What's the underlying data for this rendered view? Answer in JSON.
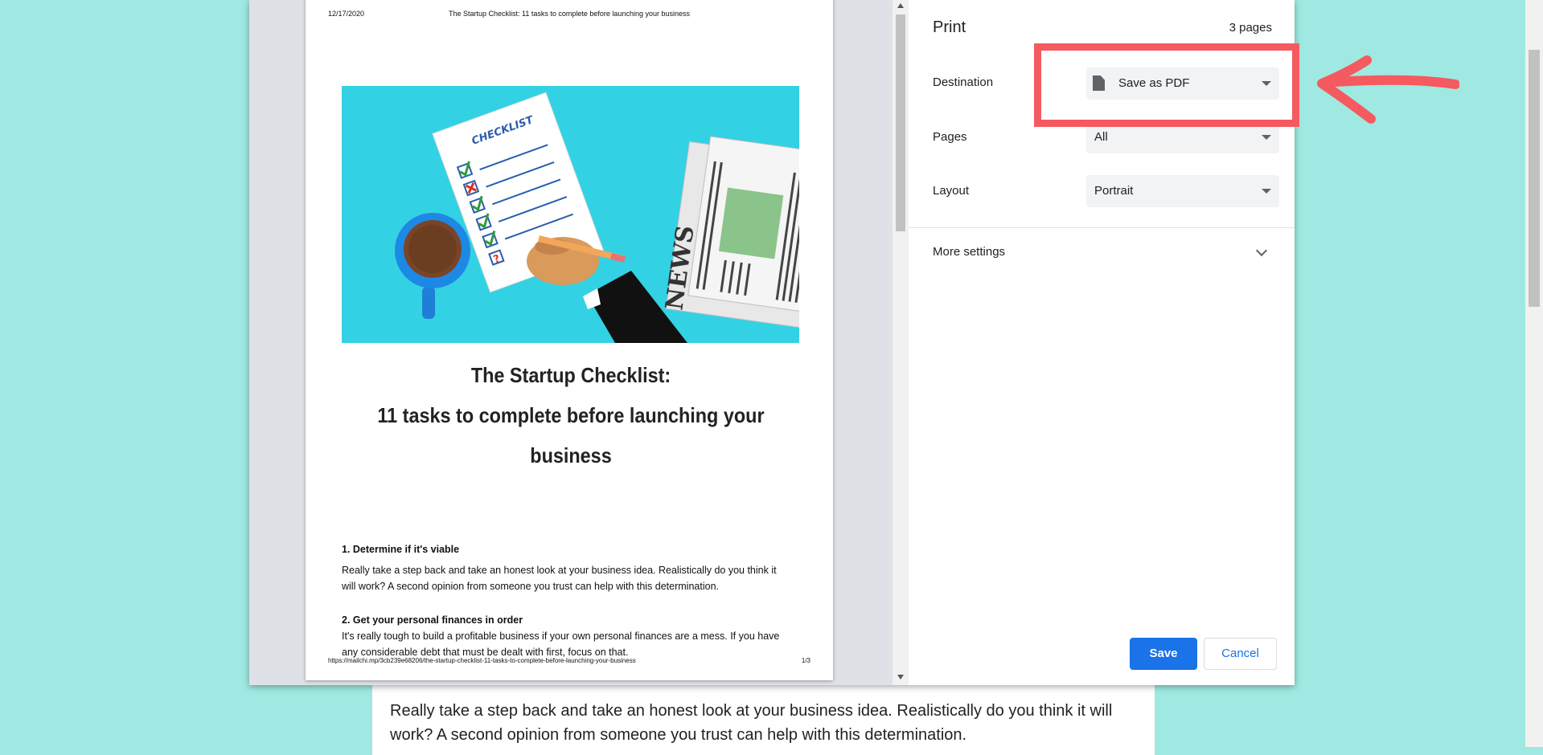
{
  "article": {
    "text": "Really take a step back and take an honest look at your business idea. Realistically do you think it will work? A second opinion from someone you trust can help with this determination."
  },
  "preview": {
    "header_date": "12/17/2020",
    "header_title": "The Startup Checklist: 11 tasks to complete before launching your business",
    "hero": {
      "checklist_label": "CHECKLIST",
      "news_label": "NEWS",
      "colors": {
        "background": "#33d1e4",
        "mug": "#1e88e5",
        "coffee": "#6b3e21",
        "paper": "#ffffff"
      }
    },
    "heading_line1": "The Startup Checklist:",
    "heading_line2": "11 tasks to complete before launching your",
    "heading_line3": "business",
    "sections": [
      {
        "title": "1. Determine if it's viable",
        "line1": "Really take a step back and take an honest look at your business idea. Realistically do you think it",
        "line2": "will work? A second opinion from someone you trust can help with this determination."
      },
      {
        "title": "2. Get your personal finances in order",
        "line1": "It's really tough to build a profitable business if your own personal finances are a mess. If you have",
        "line2": "any considerable debt that must be dealt with first, focus on that."
      }
    ],
    "footer_url": "https://mailchi.mp/3cb239e68206/the-startup-checklist-11-tasks-to-complete-before-launching-your-business",
    "footer_page": "1/3"
  },
  "settings": {
    "title": "Print",
    "page_count": "3 pages",
    "destination": {
      "label": "Destination",
      "value": "Save as PDF",
      "icon": "document-icon"
    },
    "pages": {
      "label": "Pages",
      "value": "All"
    },
    "layout": {
      "label": "Layout",
      "value": "Portrait"
    },
    "more_settings": "More settings",
    "save_label": "Save",
    "cancel_label": "Cancel"
  },
  "colors": {
    "page_background": "#9fe9e2",
    "primary_button": "#1a73e8",
    "annotation": "#f45a5f"
  }
}
